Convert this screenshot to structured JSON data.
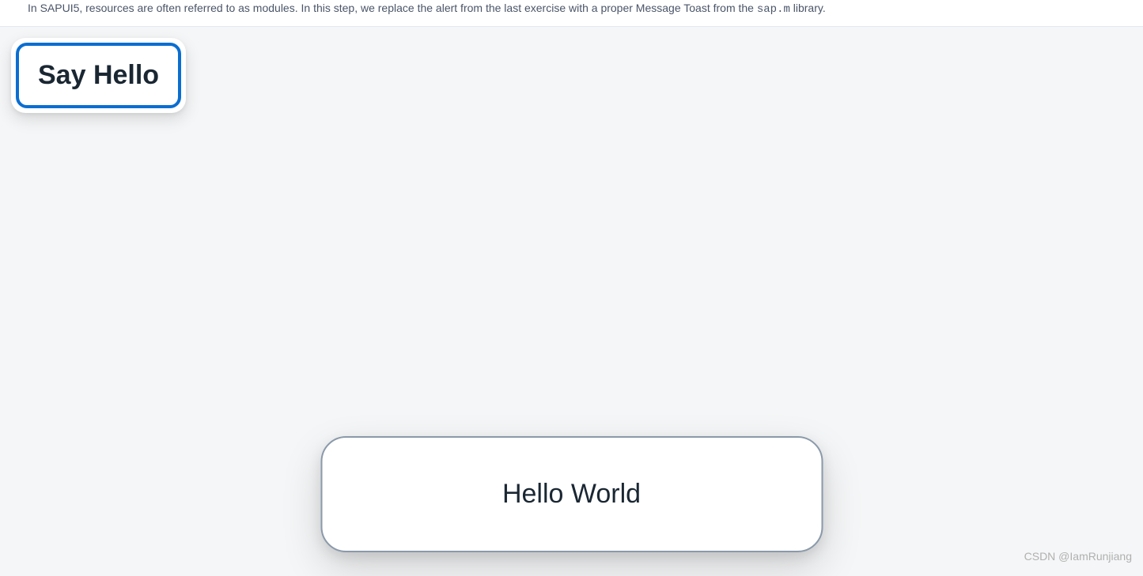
{
  "header": {
    "description_prefix": "In SAPUI5, resources are often referred to as modules. In this step, we replace the alert from the last exercise with a proper Message Toast from the ",
    "code_text": "sap.m",
    "description_suffix": " library."
  },
  "button": {
    "label": "Say Hello"
  },
  "toast": {
    "message": "Hello World"
  },
  "watermark": {
    "text": "CSDN @IamRunjiang"
  }
}
